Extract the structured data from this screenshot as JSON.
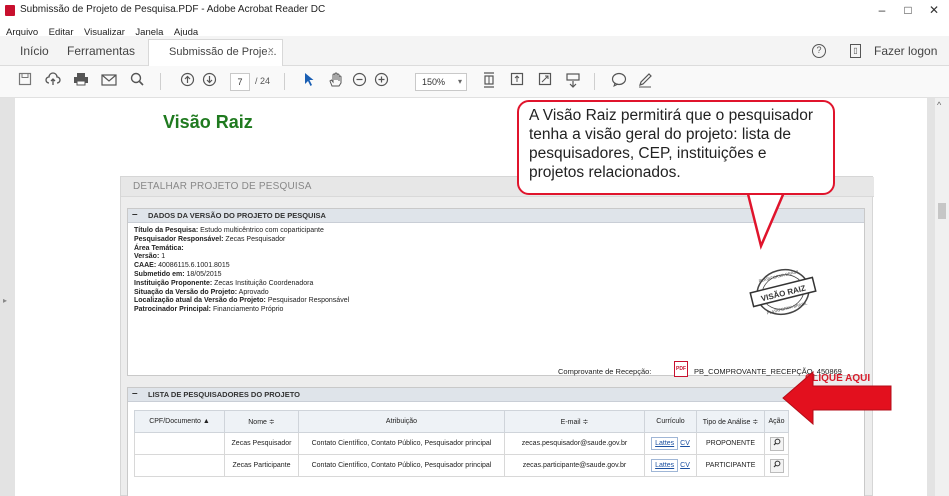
{
  "window": {
    "title": "Submissão de Projeto de Pesquisa.PDF - Adobe Acrobat Reader DC",
    "controls": [
      "–",
      "□",
      "✕"
    ]
  },
  "menu": [
    "Arquivo",
    "Editar",
    "Visualizar",
    "Janela",
    "Ajuda"
  ],
  "tabs": {
    "home": "Início",
    "tools": "Ferramentas",
    "document": "Submissão de Proje...",
    "close": "×",
    "logout": "Fazer logon"
  },
  "toolbar": {
    "page_current": "7",
    "page_total": "/ 24",
    "zoom": "150%"
  },
  "icons": {
    "save": "save-icon",
    "upload": "cloud-upload-icon",
    "print": "print-icon",
    "email": "email-icon",
    "search": "search-icon",
    "page_up": "arrow-up-icon",
    "page_down": "arrow-down-icon",
    "select": "cursor-icon",
    "hand": "hand-icon",
    "zoom_out": "zoom-out-icon",
    "zoom_in": "zoom-in-icon",
    "fit": "fit-page-icon",
    "scroll": "scroll-icon",
    "fullscreen": "fullscreen-icon",
    "read": "read-mode-icon",
    "comment": "comment-icon",
    "sign": "pen-icon"
  },
  "doc": {
    "heading": "Visão Raiz",
    "callout": "A Visão Raiz permitirá que o pesquisador tenha a visão geral do projeto: lista de pesquisadores, CEP, instituições e projetos relacionados.",
    "clique_label": "CLIQUE AQUI",
    "panel_title": "DETALHAR PROJETO DE PESQUISA",
    "section1": {
      "title": "DADOS DA VERSÃO DO PROJETO DE PESQUISA",
      "fields": [
        {
          "label": "Título da Pesquisa:",
          "value": " Estudo multicêntrico com coparticipante"
        },
        {
          "label": "Pesquisador Responsável:",
          "value": " Zecas Pesquisador"
        },
        {
          "label": "Área Temática:",
          "value": ""
        },
        {
          "label": "Versão:",
          "value": " 1"
        },
        {
          "label": "CAAE:",
          "value": " 40086115.6.1001.8015"
        },
        {
          "label": "Submetido em:",
          "value": " 18/05/2015"
        },
        {
          "label": "Instituição Proponente:",
          "value": " Zecas Instituição Coordenadora"
        },
        {
          "label": "Situação da Versão do Projeto:",
          "value": " Aprovado"
        },
        {
          "label": "Localização atual da Versão do Projeto:",
          "value": " Pesquisador Responsável"
        },
        {
          "label": "Patrocinador Principal:",
          "value": "  Financiamento Próprio"
        }
      ],
      "stamp_top": "PLATAFORMA BRASIL",
      "stamp_main": "VISÃO RAIZ",
      "stamp_bottom": "PLATAFORMA BRASIL",
      "comprovante_label": "Comprovante de Recepção:",
      "comprovante_icon": "PDF",
      "comprovante_file": "PB_COMPROVANTE_RECEPÇÃO_450869"
    },
    "section2": {
      "title": "LISTA DE PESQUISADORES DO PROJETO",
      "headers": [
        "CPF/Documento ▲",
        "Nome ≑",
        "Atribuição",
        "E-mail ≑",
        "Currículo",
        "Tipo de Análise ≑",
        "Ação"
      ],
      "rows": [
        {
          "cpf": "",
          "nome": "Zecas Pesquisador",
          "atribuicao": "Contato Científico, Contato Público, Pesquisador principal",
          "email": "zecas.pesquisador@saude.gov.br",
          "lattes": "Lattes",
          "cv": "CV",
          "tipo": "PROPONENTE"
        },
        {
          "cpf": "",
          "nome": "Zecas Participante",
          "atribuicao": "Contato Científico, Contato Público, Pesquisador principal",
          "email": "zecas.participante@saude.gov.br",
          "lattes": "Lattes",
          "cv": "CV",
          "tipo": "PARTICIPANTE"
        }
      ]
    }
  },
  "colors": {
    "heading_green": "#1f7a1f",
    "callout_border": "#e0142c",
    "arrow_red": "#e3101e"
  }
}
